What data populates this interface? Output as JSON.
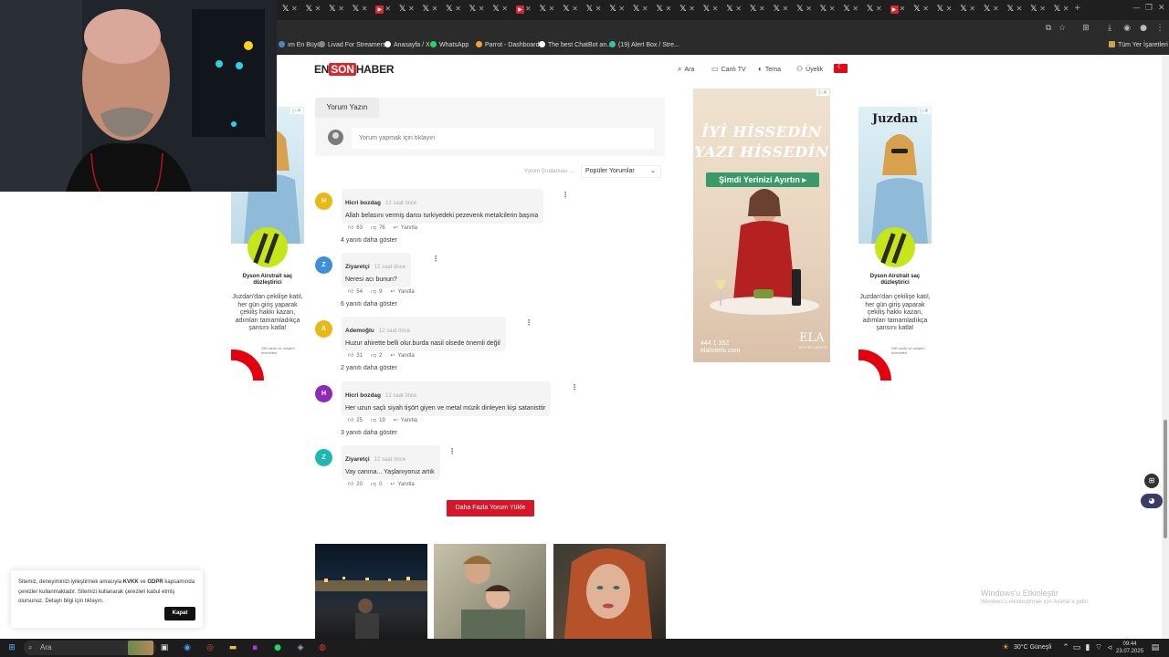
{
  "browser": {
    "tab_count_x": 34,
    "bookmarks": [
      {
        "label": "ım En Büyü..",
        "color": "#4a86c7"
      },
      {
        "label": "Livad For Streamers",
        "color": "#888888"
      },
      {
        "label": "Anasayfa / X",
        "color": "#ffffff"
      },
      {
        "label": "WhatsApp",
        "color": "#25d366"
      },
      {
        "label": "Parrot - Dashboard",
        "color": "#f0a030"
      },
      {
        "label": "The best ChatBot an...",
        "color": "#ffffff"
      },
      {
        "label": "(19) Alert Box / Stre...",
        "color": "#39c0a0"
      }
    ],
    "all_bookmarks": "Tüm Yer İşaretleri"
  },
  "site": {
    "logo": {
      "part1": "EN",
      "part2": "SON",
      "part3": "HABER"
    },
    "nav": {
      "search": "Ara",
      "live_tv": "Canlı TV",
      "theme": "Tema",
      "membership": "Üyelik"
    },
    "colors": {
      "brand_red": "#d6282e",
      "button_red": "#d6162a"
    }
  },
  "comments_section": {
    "tab_label": "Yorum Yazın",
    "input_placeholder": "Yorum yapmak için tıklayın",
    "sort_label": "Yorum Sıralaması",
    "sort_value": "Popüler Yorumlar",
    "reply_label": "Yanıtla",
    "items": [
      {
        "initial": "H",
        "color": "#e8b818",
        "author": "Hicri bozdag",
        "time": "12 saat önce",
        "text": "Allah belasını vermiş dansı turkiyedeki pezevenk metalcilerin başına",
        "likes": "63",
        "dislikes": "76",
        "replies": "4 yanıtı daha göster"
      },
      {
        "initial": "Z",
        "color": "#3f8fd8",
        "author": "Ziyaretçi",
        "time": "12 saat önce",
        "text": "Neresi acı bunun?",
        "likes": "54",
        "dislikes": "9",
        "replies": "6 yanıtı daha göster"
      },
      {
        "initial": "A",
        "color": "#e8b818",
        "author": "Ademoğlu",
        "time": "12 saat önce",
        "text": "Huzur ahirette belli olur.burda nasil olsede önemli değil",
        "likes": "31",
        "dislikes": "2",
        "replies": "2 yanıtı daha göster"
      },
      {
        "initial": "H",
        "color": "#8e2ab8",
        "author": "Hicri bozdag",
        "time": "12 saat önce",
        "text": "Her uzun saçlı siyah tişört giyen ve metal müzik dinleyen kişi satanisttir",
        "likes": "25",
        "dislikes": "19",
        "replies": "3 yanıtı daha göster"
      },
      {
        "initial": "Z",
        "color": "#1fb8b0",
        "author": "Ziyaretçi",
        "time": "12 saat önce",
        "text": "Vay canına... Yaşlanıyoruz artık",
        "likes": "20",
        "dislikes": "0",
        "replies": ""
      }
    ],
    "load_more": "Daha Fazla Yorum Yükle"
  },
  "ads": {
    "center": {
      "line1": "İYİ HİSSEDİN",
      "line2": "YAZI HİSSEDİN",
      "cta": "Şimdi Yerinizi Ayırtın",
      "phone": "444 1 352",
      "site": "elahotels.com",
      "brand": "ELA",
      "brand_sub": "EXCELLENCE"
    },
    "side": {
      "brand": "Juzdan",
      "device": "Dyson Airstrait saç düzleştirici",
      "body": "Juzdan'dan çekilişe katıl, her gün giriş yaparak çekiliş hakkı kazan, adımları tamamladıkça şansını katla!",
      "fine": "Gift cards ve müşteri hizmetleri"
    }
  },
  "cookie": {
    "text_before": "Sitemiz, deneyiminizi iyileştirmek amacıyla ",
    "kvkk": "KVKK",
    "and": " ve ",
    "gdpr": "GDPR",
    "text_after": " kapsamında çerezler kullanmaktadır. Sitemizi kullanarak çerezleri kabul etmiş olursunuz. Detaylı bilgi için tıklayın.",
    "button": "Kapat"
  },
  "watermark": {
    "title": "Windows'u Etkinleştir",
    "subtitle": "Windows'u etkinleştirmek için Ayarlar'a gidin."
  },
  "taskbar": {
    "search": "Ara",
    "weather": "30°C",
    "weather_desc": "Güneşli",
    "time": "09:44",
    "date": "23.07.2025"
  }
}
